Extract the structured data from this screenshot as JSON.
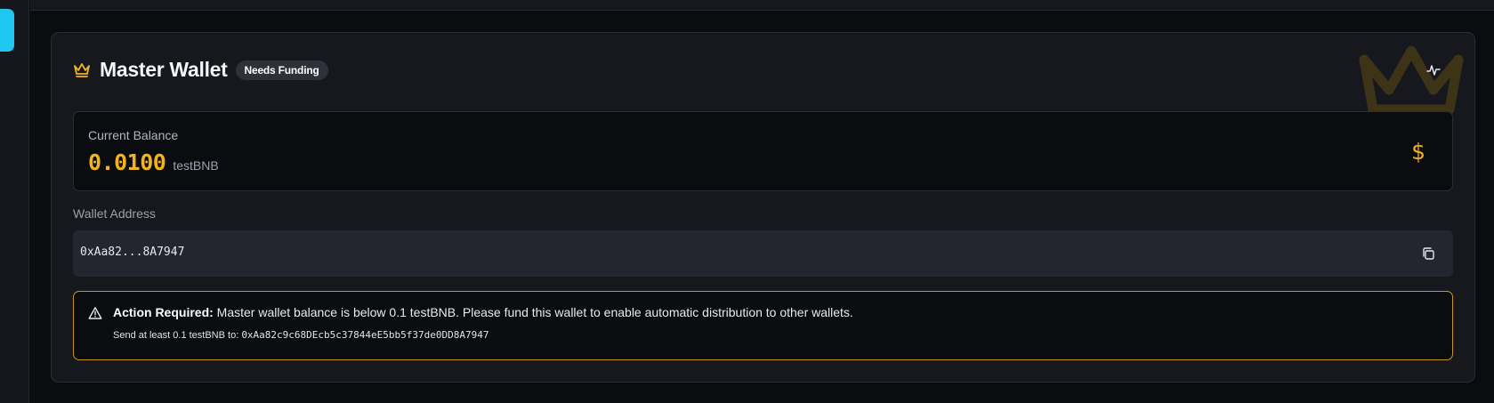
{
  "colors": {
    "accent": "#1ec8f2",
    "gold": "#f2b41c",
    "alert_border": "#c7961a",
    "background": "#0b0c0f",
    "card": "#16181d"
  },
  "wallet": {
    "title": "Master Wallet",
    "badge": "Needs Funding",
    "icons": {
      "title": "crown-icon",
      "activity": "activity-icon",
      "watermark": "crown-watermark-icon",
      "currency": "dollar-icon",
      "copy": "copy-icon",
      "alert": "warning-icon"
    }
  },
  "balance": {
    "label": "Current Balance",
    "value": "0.0100",
    "unit": "testBNB",
    "currency_symbol": "$"
  },
  "address": {
    "label": "Wallet Address",
    "short": "0xAa82...8A7947"
  },
  "alert": {
    "heading": "Action Required:",
    "message": " Master wallet balance is below 0.1 testBNB. Please fund this wallet to enable automatic distribution to other wallets.",
    "send_prefix": "Send at least 0.1 testBNB to: ",
    "full_address": "0xAa82c9c68DEcb5c37844eE5bb5f37de0DD8A7947"
  }
}
